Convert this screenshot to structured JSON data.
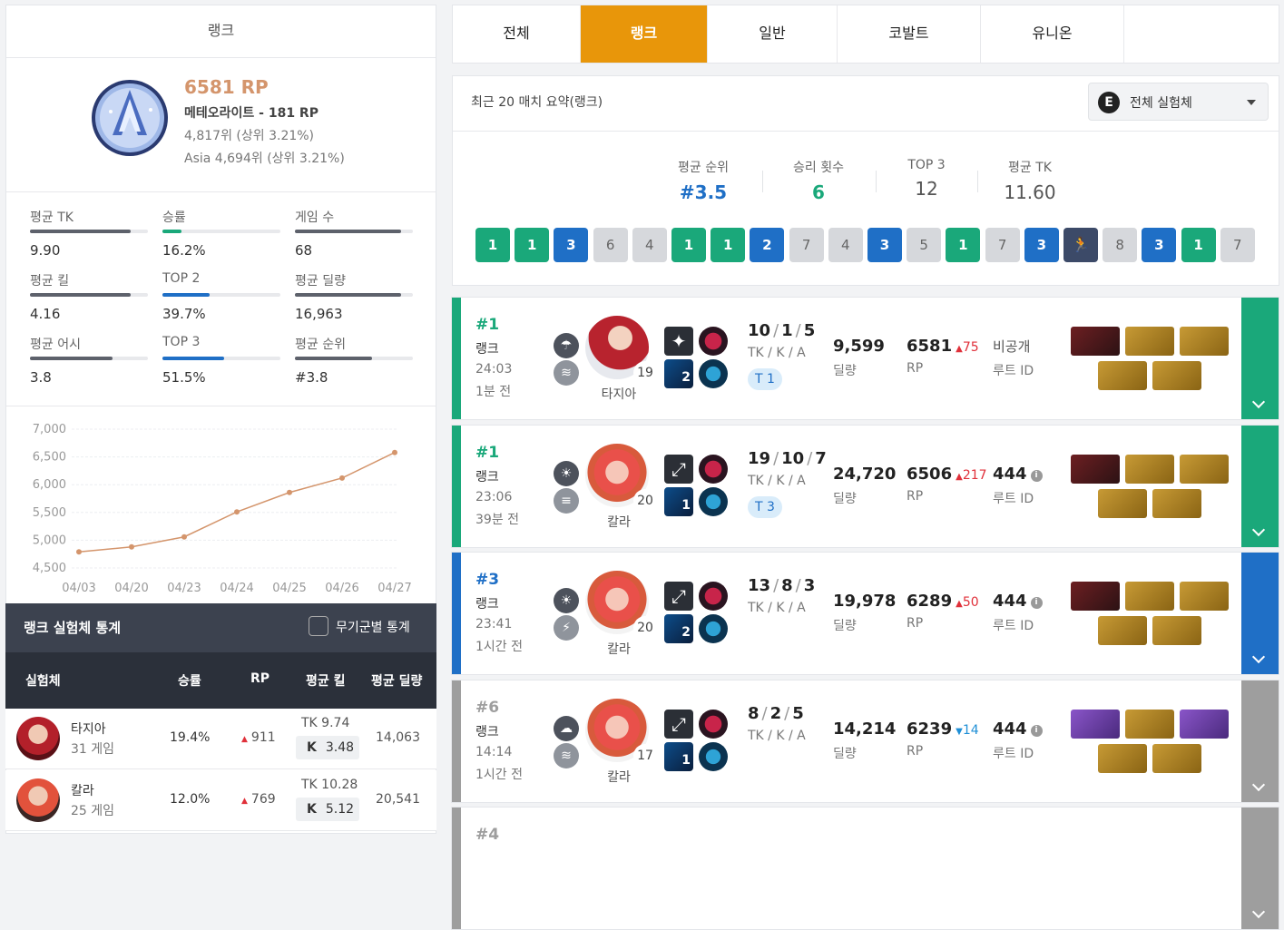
{
  "left": {
    "title": "랭크",
    "rp": "6581 RP",
    "tier": "메테오라이트 - 181 RP",
    "rank_global": "4,817위 (상위 3.21%)",
    "rank_asia": "Asia 4,694위 (상위 3.21%)",
    "stats": [
      {
        "label": "평균 TK",
        "value": "9.90",
        "fill": 0.85
      },
      {
        "label": "승률",
        "value": "16.2%",
        "fill": 0.16
      },
      {
        "label": "게임 수",
        "value": "68",
        "fill": 0.9
      },
      {
        "label": "평균 킬",
        "value": "4.16",
        "fill": 0.85
      },
      {
        "label": "TOP 2",
        "value": "39.7%",
        "fill": 0.4
      },
      {
        "label": "평균 딜량",
        "value": "16,963",
        "fill": 0.9
      },
      {
        "label": "평균 어시",
        "value": "3.8",
        "fill": 0.7
      },
      {
        "label": "TOP 3",
        "value": "51.5%",
        "fill": 0.52
      },
      {
        "label": "평균 순위",
        "value": "#3.8",
        "fill": 0.65
      }
    ]
  },
  "chart_data": {
    "type": "line",
    "categories": [
      "04/03",
      "04/20",
      "04/23",
      "04/24",
      "04/25",
      "04/26",
      "04/27"
    ],
    "values": [
      4790,
      4880,
      5060,
      5510,
      5860,
      6120,
      6580
    ],
    "yticks": [
      "7,000",
      "6,500",
      "6,000",
      "5,500",
      "5,000",
      "4,500"
    ],
    "ylim": [
      4500,
      7000
    ],
    "color": "#d4956c"
  },
  "table": {
    "title": "랭크 실험체 통계",
    "weapon_toggle": "무기군별 통계",
    "columns": [
      "실험체",
      "승률",
      "RP",
      "평균 킬",
      "평균 딜량"
    ],
    "rows": [
      {
        "name": "타지아",
        "games": "31 게임",
        "winrate": "19.4%",
        "rp": "911",
        "tk": "TK 9.74",
        "k_label": "K",
        "k": "3.48",
        "dmg": "14,063"
      },
      {
        "name": "칼라",
        "games": "25 게임",
        "winrate": "12.0%",
        "rp": "769",
        "tk": "TK 10.28",
        "k_label": "K",
        "k": "5.12",
        "dmg": "20,541"
      }
    ]
  },
  "tabs": [
    "전체",
    "랭크",
    "일반",
    "코발트",
    "유니온"
  ],
  "summary": {
    "title": "최근 20 매치 요약(랭크)",
    "dropdown_icon": "E",
    "dropdown": "전체 실험체",
    "metrics": [
      {
        "label": "평균 순위",
        "value": "#3.5",
        "color": "#1f6fc6"
      },
      {
        "label": "승리 횟수",
        "value": "6",
        "color": "#1aa87a"
      },
      {
        "label": "TOP 3",
        "value": "12",
        "color": "#555555"
      },
      {
        "label": "평균 TK",
        "value": "11.60",
        "color": "#555555"
      }
    ],
    "placements": [
      "1",
      "1",
      "3",
      "6",
      "4",
      "1",
      "1",
      "2",
      "7",
      "4",
      "3",
      "5",
      "1",
      "7",
      "3",
      "run",
      "8",
      "3",
      "1",
      "7"
    ]
  },
  "matches": [
    {
      "rank": "#1",
      "mode": "랭크",
      "time": "24:03",
      "ago": "1분 전",
      "color": "#1aa87a",
      "weather1": "rain-cloud-icon",
      "weather2": "wind-icon",
      "char": "타지아",
      "char_key": "tazia",
      "level": "19",
      "weapon_level": "2",
      "kda": [
        "10",
        "1",
        "5"
      ],
      "kda_label": "TK / K / A",
      "team_badge": "T 1",
      "damage": "9,599",
      "damage_label": "딜량",
      "rp": "6581",
      "rp_delta": "75",
      "rp_dir": "up",
      "rp_label": "RP",
      "route": "비공개",
      "route_label": "루트 ID",
      "items": [
        "red",
        "gold",
        "gold",
        "gold",
        "gold"
      ]
    },
    {
      "rank": "#1",
      "mode": "랭크",
      "time": "23:06",
      "ago": "39분 전",
      "color": "#1aa87a",
      "weather1": "sun-icon",
      "weather2": "fog-icon",
      "char": "칼라",
      "char_key": "carla",
      "level": "20",
      "weapon_level": "1",
      "kda": [
        "19",
        "10",
        "7"
      ],
      "kda_label": "TK / K / A",
      "team_badge": "T 3",
      "damage": "24,720",
      "damage_label": "딜량",
      "rp": "6506",
      "rp_delta": "217",
      "rp_dir": "up",
      "rp_label": "RP",
      "route": "444",
      "route_label": "루트 ID",
      "items": [
        "red",
        "gold",
        "gold",
        "gold",
        "gold"
      ]
    },
    {
      "rank": "#3",
      "mode": "랭크",
      "time": "23:41",
      "ago": "1시간 전",
      "color": "#1f6fc6",
      "weather1": "sun-icon",
      "weather2": "storm-icon",
      "char": "칼라",
      "char_key": "carla",
      "level": "20",
      "weapon_level": "2",
      "kda": [
        "13",
        "8",
        "3"
      ],
      "kda_label": "TK / K / A",
      "team_badge": "",
      "damage": "19,978",
      "damage_label": "딜량",
      "rp": "6289",
      "rp_delta": "50",
      "rp_dir": "up",
      "rp_label": "RP",
      "route": "444",
      "route_label": "루트 ID",
      "items": [
        "red",
        "gold",
        "gold",
        "gold",
        "gold"
      ]
    },
    {
      "rank": "#6",
      "mode": "랭크",
      "time": "14:14",
      "ago": "1시간 전",
      "color": "#9e9e9e",
      "weather1": "cloud-icon",
      "weather2": "wind-icon",
      "char": "칼라",
      "char_key": "carla",
      "level": "17",
      "weapon_level": "1",
      "kda": [
        "8",
        "2",
        "5"
      ],
      "kda_label": "TK / K / A",
      "team_badge": "",
      "damage": "14,214",
      "damage_label": "딜량",
      "rp": "6239",
      "rp_delta": "14",
      "rp_dir": "down",
      "rp_label": "RP",
      "route": "444",
      "route_label": "루트 ID",
      "items": [
        "purp",
        "gold",
        "purp",
        "gold",
        "gold"
      ]
    },
    {
      "rank": "#4",
      "color": "#9e9e9e"
    }
  ]
}
